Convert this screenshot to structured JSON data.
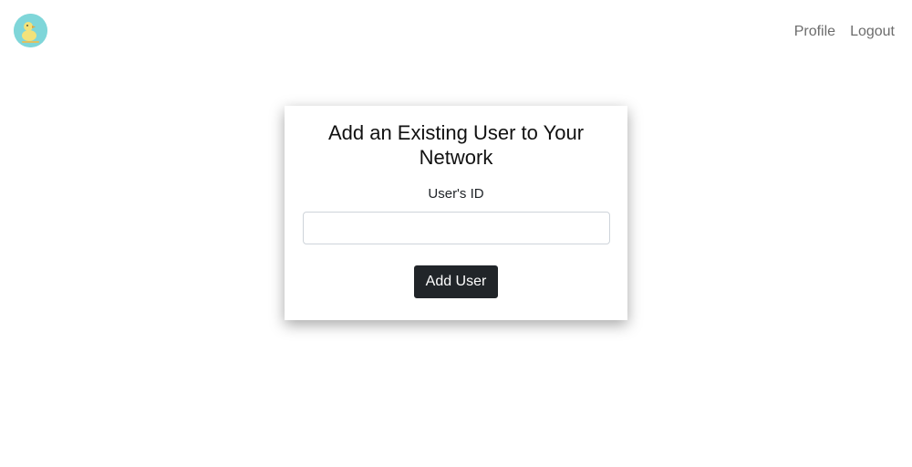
{
  "nav": {
    "links": [
      {
        "label": "Profile"
      },
      {
        "label": "Logout"
      }
    ]
  },
  "form": {
    "title": "Add an Existing User to Your Network",
    "field_label": "User's ID",
    "input_value": "",
    "input_placeholder": "",
    "submit_label": "Add User"
  },
  "colors": {
    "logo_background": "#7fd6d9",
    "button_background": "#212529",
    "nav_link_color": "#6c6c6c"
  },
  "icons": {
    "logo": "duck-logo-icon"
  }
}
